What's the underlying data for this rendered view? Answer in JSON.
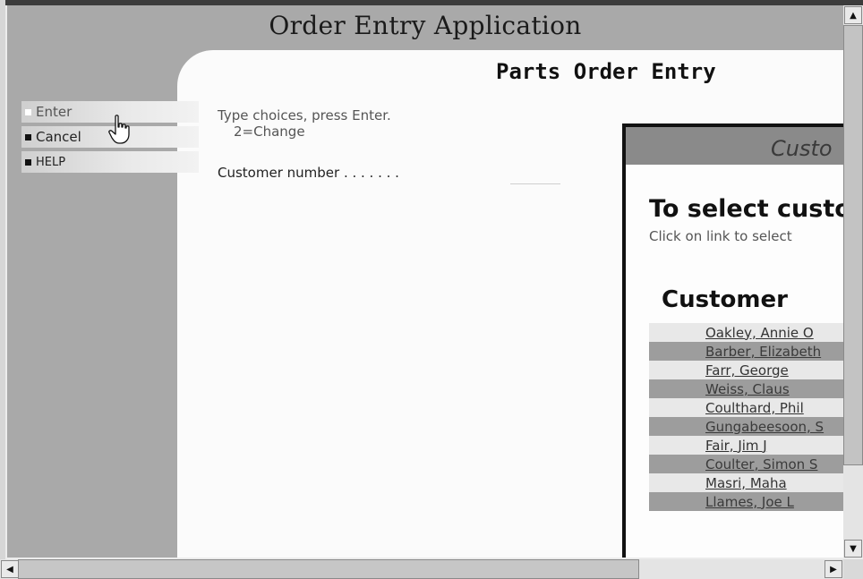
{
  "app": {
    "title": "Order Entry Application",
    "page_title": "Parts Order Entry"
  },
  "menu": {
    "items": [
      {
        "label": "Enter"
      },
      {
        "label": "Cancel"
      },
      {
        "label": "HELP"
      }
    ]
  },
  "form": {
    "instructions_line1": "Type choices, press Enter.",
    "instructions_line2": "2=Change",
    "customer_number_label": "Customer number . . . . . . .",
    "customer_number_value": ""
  },
  "popup": {
    "header": "Custo",
    "heading": "To select custo",
    "subtext": "Click on link to select",
    "column_header": "Customer",
    "customers": [
      "Oakley, Annie O",
      "Barber, Elizabeth",
      "Farr, George",
      "Weiss, Claus",
      "Coulthard, Phil",
      "Gungabeesoon, S",
      "Fair, Jim J",
      "Coulter, Simon S",
      "Masri, Maha",
      "Llames, Joe L"
    ]
  },
  "icons": {
    "cursor": "hand-pointer-icon",
    "scroll_up": "arrow-up-icon",
    "scroll_down": "arrow-down-icon",
    "scroll_left": "arrow-left-icon",
    "scroll_right": "arrow-right-icon"
  }
}
